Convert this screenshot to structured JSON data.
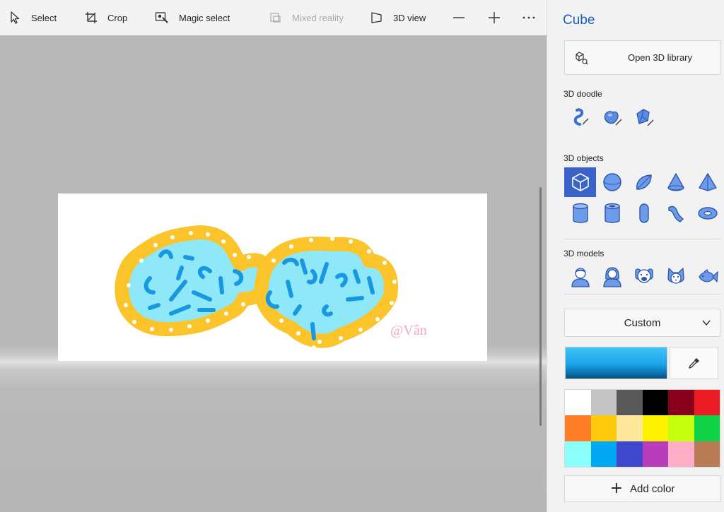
{
  "toolbar": {
    "select_label": "Select",
    "crop_label": "Crop",
    "magic_select_label": "Magic select",
    "mixed_reality_label": "Mixed reality",
    "view3d_label": "3D view",
    "zoom_out_icon": "minus-icon",
    "zoom_in_icon": "plus-icon",
    "more_icon": "more-icon"
  },
  "canvas": {
    "watermark": "@Vân"
  },
  "panel": {
    "title": "Cube",
    "open_library_label": "Open 3D library",
    "doodle_label": "3D doodle",
    "doodle_tools": [
      "sharp-edge-doodle",
      "soft-edge-doodle",
      "tube-doodle"
    ],
    "objects_label": "3D objects",
    "objects_row1": [
      "cube",
      "sphere",
      "hemisphere",
      "cone",
      "pyramid"
    ],
    "objects_row2": [
      "cylinder",
      "tube",
      "capsule",
      "curved-tube",
      "donut"
    ],
    "selected_object": "cube",
    "models_label": "3D models",
    "models": [
      "man",
      "woman",
      "dog",
      "cat",
      "fish"
    ],
    "material_dropdown": "Custom",
    "current_color": "#1aa3e8",
    "palette": [
      "#ffffff",
      "#c3c3c3",
      "#585858",
      "#000000",
      "#88001b",
      "#ec1c24",
      "#ff7f27",
      "#ffc90e",
      "#fde89c",
      "#fff200",
      "#c4ff0e",
      "#0ed145",
      "#8cfffb",
      "#00a8f3",
      "#3f48cc",
      "#b83dba",
      "#ffaec8",
      "#b97a56"
    ],
    "add_color_label": "Add color"
  }
}
